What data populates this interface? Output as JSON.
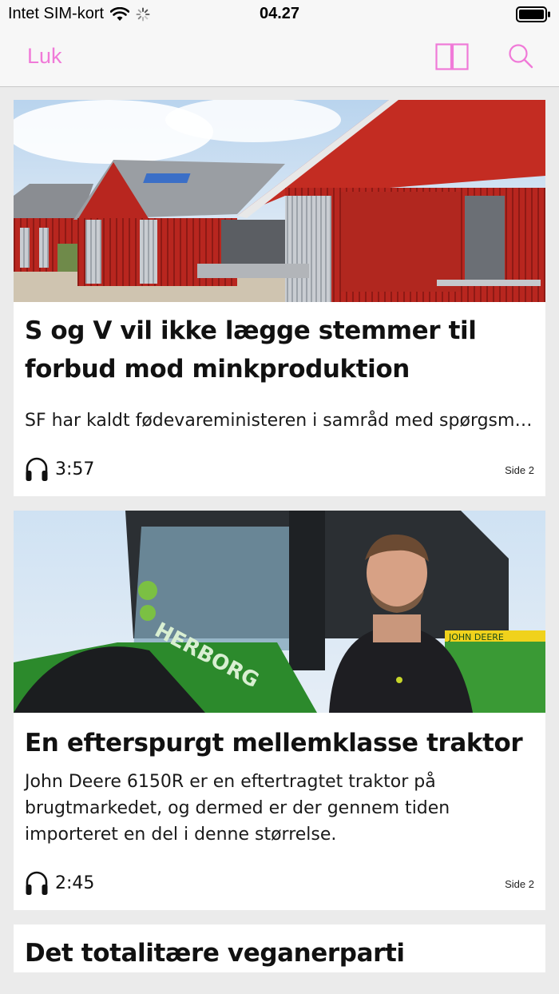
{
  "status": {
    "carrier": "Intet SIM-kort",
    "time": "04.27"
  },
  "nav": {
    "close_label": "Luk",
    "layout_icon": "two-column-layout-icon",
    "search_icon": "search-icon",
    "accent_color": "#f07ad8"
  },
  "articles": [
    {
      "title": "S og V vil ikke lægge stemmer til forbud mod minkproduktion",
      "summary": "SF har kaldt fødevareministeren i samråd med spørgsmål om",
      "duration": "3:57",
      "page": "Side 2"
    },
    {
      "title": "En efterspurgt mellemklasse traktor",
      "summary": "John Deere 6150R er en eftertragtet traktor på brugtmarkedet, og dermed er der gennem tiden importeret en del i denne størrelse.",
      "duration": "2:45",
      "page": "Side 2",
      "image_text": "HERBORG"
    },
    {
      "title": "Det totalitære veganerparti"
    }
  ]
}
